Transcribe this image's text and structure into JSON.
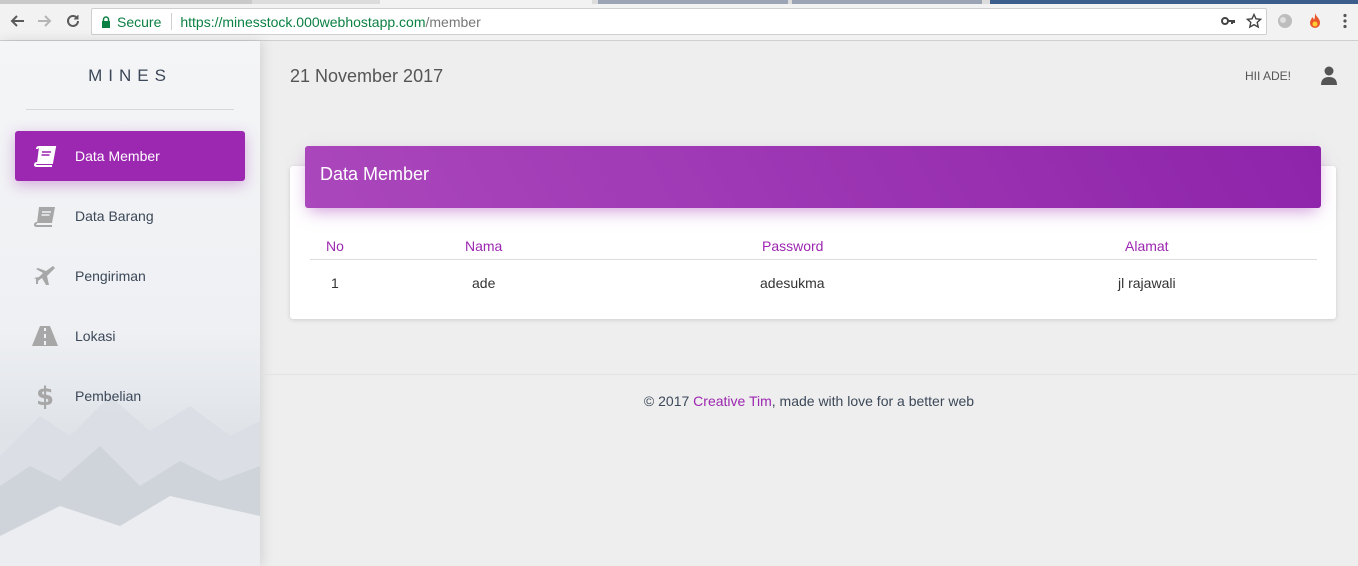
{
  "browser": {
    "secure_label": "Secure",
    "url_host": "https://minesstock.000webhostapp.com",
    "url_path": "/member"
  },
  "sidebar": {
    "logo": "MINES",
    "items": [
      {
        "label": "Data Member",
        "icon": "book-icon",
        "active": true
      },
      {
        "label": "Data Barang",
        "icon": "book-icon",
        "active": false
      },
      {
        "label": "Pengiriman",
        "icon": "airplane-icon",
        "active": false
      },
      {
        "label": "Lokasi",
        "icon": "road-icon",
        "active": false
      },
      {
        "label": "Pembelian",
        "icon": "dollar-icon",
        "active": false
      }
    ]
  },
  "header": {
    "date": "21 November 2017",
    "greeting": "HII ADE!",
    "user_icon": "user-icon"
  },
  "card": {
    "title": "Data Member",
    "columns": [
      "No",
      "Nama",
      "Password",
      "Alamat"
    ],
    "rows": [
      [
        "1",
        "ade",
        "adesukma",
        "jl rajawali"
      ]
    ]
  },
  "footer": {
    "prefix": "© 2017 ",
    "link": "Creative Tim",
    "suffix": ", made with love for a better web"
  },
  "colors": {
    "accent": "#9c27b0",
    "secure_green": "#0b8043"
  }
}
